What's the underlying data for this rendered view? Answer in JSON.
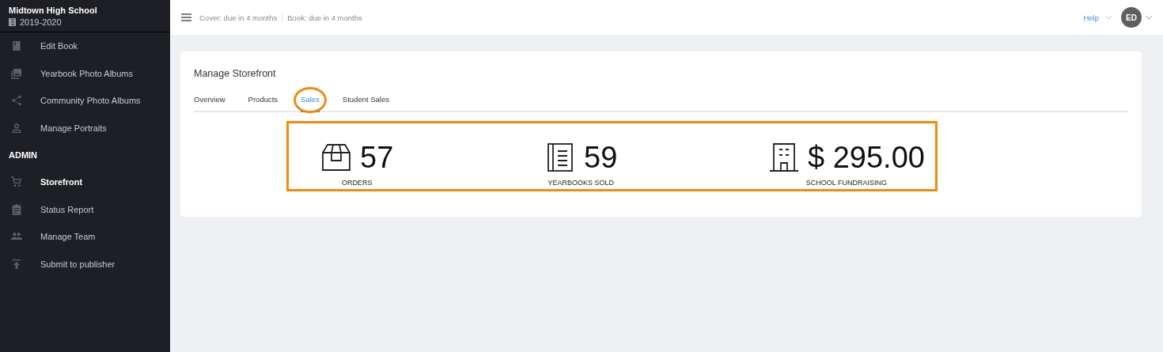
{
  "sidebar": {
    "school": "Midtown High School",
    "year": "2019-2020",
    "sections": [
      {
        "items": [
          {
            "label": "Edit Book",
            "selected": false
          },
          {
            "label": "Yearbook Photo Albums",
            "selected": false
          },
          {
            "label": "Community Photo Albums",
            "selected": false
          },
          {
            "label": "Manage Portraits",
            "selected": false
          }
        ]
      },
      {
        "heading": "ADMIN",
        "items": [
          {
            "label": "Storefront",
            "selected": true
          },
          {
            "label": "Status Report",
            "selected": false
          },
          {
            "label": "Manage Team",
            "selected": false
          },
          {
            "label": "Submit to publisher",
            "selected": false
          }
        ]
      }
    ]
  },
  "header": {
    "deadlines": [
      "Cover: due in 4 months",
      "Book: due in 4 months"
    ],
    "help": "Help",
    "avatar": "ED"
  },
  "card": {
    "title": "Manage Storefront",
    "tabs": [
      {
        "label": "Overview",
        "selected": false,
        "circled": false
      },
      {
        "label": "Products",
        "selected": false,
        "circled": false
      },
      {
        "label": "Sales",
        "selected": true,
        "circled": true
      },
      {
        "label": "Student Sales",
        "selected": false,
        "circled": false
      }
    ],
    "stats_highlighted": true,
    "stats": [
      {
        "value": "57",
        "label": "ORDERS"
      },
      {
        "value": "59",
        "label": "YEARBOOKS SOLD"
      },
      {
        "value": "$ 295.00",
        "label": "SCHOOL FUNDRAISING"
      }
    ]
  }
}
